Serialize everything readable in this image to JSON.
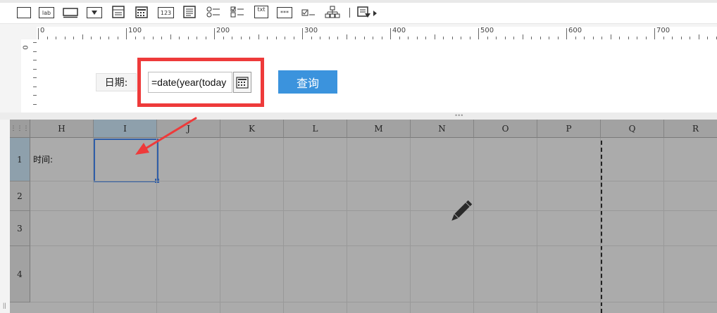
{
  "toolbar": {
    "icons": [
      "textbox-icon",
      "label-icon",
      "button-icon",
      "dropdown-icon",
      "list-icon",
      "calendar-icon",
      "number-icon",
      "textarea-icon",
      "radio-group-icon",
      "checkbox-group-icon",
      "text-icon",
      "password-icon",
      "checkbox-icon",
      "tree-icon",
      "more-icon"
    ],
    "lab_text": "lab",
    "num_text": "123",
    "txt_text": "txt",
    "pwd_text": "***"
  },
  "ruler": {
    "h_labels": [
      "0",
      "100",
      "200",
      "300",
      "400",
      "500",
      "600",
      "700"
    ],
    "v_label": "0"
  },
  "form": {
    "date_label": "日期:",
    "date_value": "=date(year(today",
    "query_label": "查询"
  },
  "grid": {
    "columns": [
      "H",
      "I",
      "J",
      "K",
      "L",
      "M",
      "N",
      "O",
      "P",
      "Q",
      "R"
    ],
    "selected_column": "I",
    "rows": [
      "1",
      "2",
      "3",
      "4"
    ],
    "selected_row": "1",
    "cells": {
      "H1": "时间:"
    }
  },
  "colors": {
    "accent": "#3b93dd",
    "highlight": "#ee3a3a",
    "selection": "#2f5ea8",
    "grid_bg": "#ababab"
  }
}
